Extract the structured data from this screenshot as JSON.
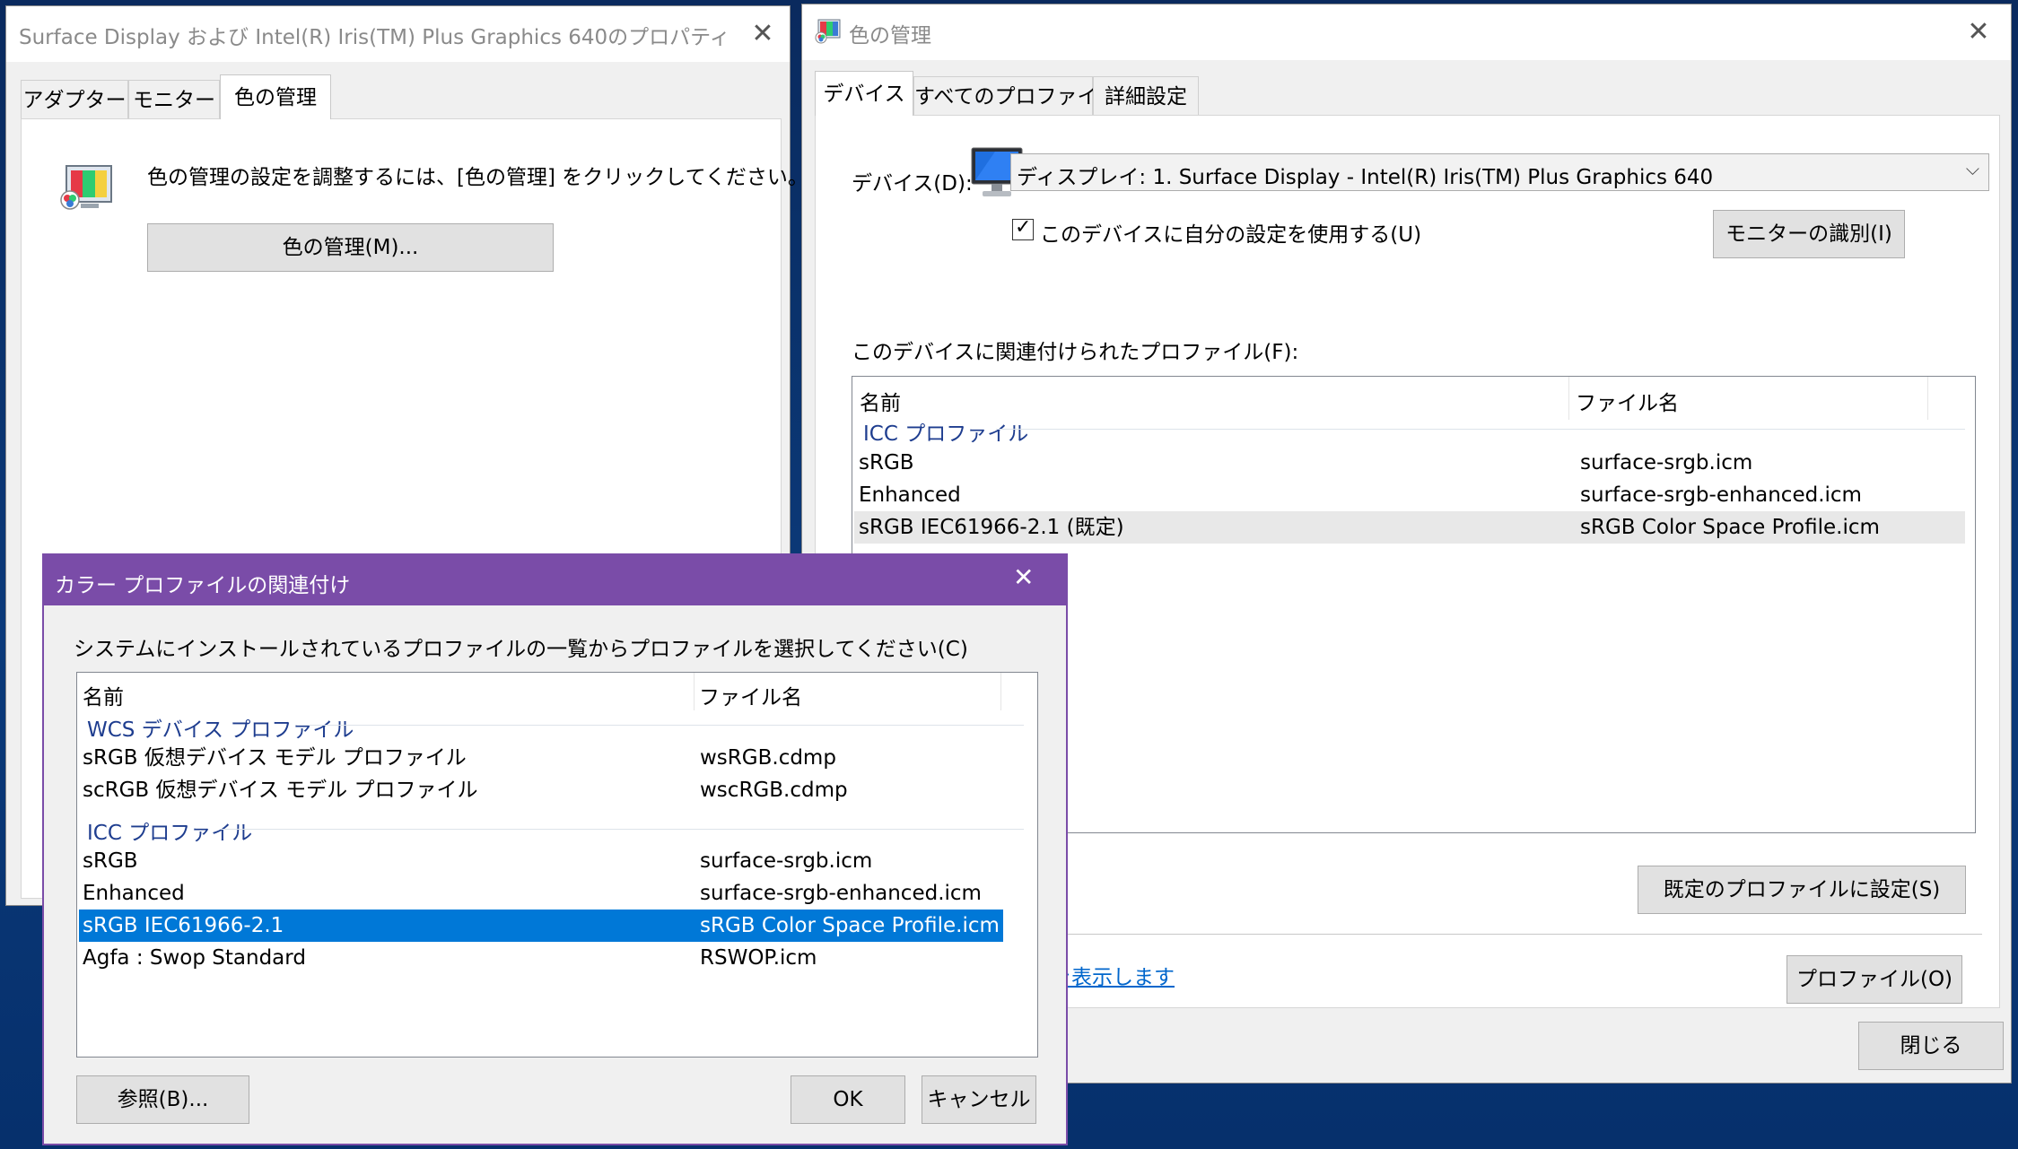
{
  "props_window": {
    "title": "Surface Display および Intel(R) Iris(TM) Plus Graphics 640のプロパティ",
    "tabs": [
      "アダプター",
      "モニター",
      "色の管理"
    ],
    "instruction": "色の管理の設定を調整するには、[色の管理] をクリックしてください。",
    "button": "色の管理(M)..."
  },
  "cm_window": {
    "title": "色の管理",
    "tabs": [
      "デバイス",
      "すべてのプロファイル",
      "詳細設定"
    ],
    "device_label": "デバイス(D):",
    "device_value": "ディスプレイ: 1. Surface Display - Intel(R) Iris(TM) Plus Graphics 640",
    "use_settings_label": "このデバイスに自分の設定を使用する(U)",
    "use_settings_checked": true,
    "identify_button": "モニターの識別(I)",
    "profiles_label": "このデバイスに関連付けられたプロファイル(F):",
    "columns": [
      "名前",
      "ファイル名"
    ],
    "group": "ICC プロファイル",
    "rows": [
      {
        "name": "sRGB",
        "file": "surface-srgb.icm"
      },
      {
        "name": "Enhanced",
        "file": "surface-srgb-enhanced.icm"
      },
      {
        "name": "sRGB IEC61966-2.1 (既定)",
        "file": "sRGB Color Space Profile.icm"
      }
    ],
    "partial_button": ")",
    "default_button": "既定のプロファイルに設定(S)",
    "link_text": "を表示します",
    "profiles_button": "プロファイル(O)",
    "close_button": "閉じる"
  },
  "assoc_dialog": {
    "title": "カラー プロファイルの関連付け",
    "instruction": "システムにインストールされているプロファイルの一覧からプロファイルを選択してください(C)",
    "columns": [
      "名前",
      "ファイル名"
    ],
    "wcs_group": "WCS デバイス プロファイル",
    "wcs_rows": [
      {
        "name": "sRGB 仮想デバイス モデル プロファイル",
        "file": "wsRGB.cdmp"
      },
      {
        "name": "scRGB 仮想デバイス モデル プロファイル",
        "file": "wscRGB.cdmp"
      }
    ],
    "icc_group": "ICC プロファイル",
    "icc_rows": [
      {
        "name": "sRGB",
        "file": "surface-srgb.icm"
      },
      {
        "name": "Enhanced",
        "file": "surface-srgb-enhanced.icm"
      },
      {
        "name": "sRGB IEC61966-2.1",
        "file": "sRGB Color Space Profile.icm"
      },
      {
        "name": "Agfa : Swop Standard",
        "file": "RSWOP.icm"
      }
    ],
    "browse_button": "参照(B)...",
    "ok_button": "OK",
    "cancel_button": "キャンセル"
  },
  "colors": {
    "dialog_title_bar": "#7a4ca8",
    "selection": "#0078d7",
    "link": "#0066cc"
  }
}
